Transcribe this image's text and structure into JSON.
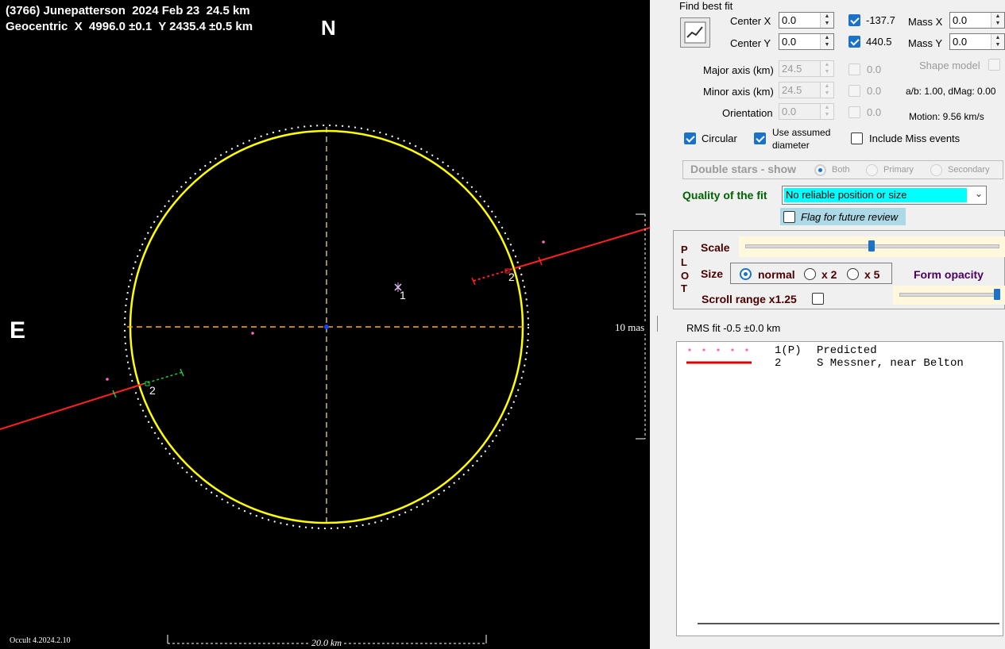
{
  "plot": {
    "title_line1": "(3766) Junepatterson  2024 Feb 23  24.5 km",
    "title_line2": "Geocentric  X  4996.0 ±0.1  Y 2435.4 ±0.5 km",
    "north_label": "N",
    "east_label": "E",
    "scale_vertical_label": "10 mas",
    "scale_horizontal_label": "20.0 km",
    "version_label": "Occult 4.2024.2.10",
    "chord_labels": [
      "1",
      "2",
      "2"
    ]
  },
  "fit": {
    "title": "Find best fit",
    "center_x_label": "Center X",
    "center_x_value": "0.0",
    "center_y_label": "Center Y",
    "center_y_value": "0.0",
    "center_x_fit": "-137.7",
    "center_y_fit": "440.5",
    "mass_x_label": "Mass X",
    "mass_x_value": "0.0",
    "mass_y_label": "Mass Y",
    "mass_y_value": "0.0",
    "major_axis_label": "Major axis (km)",
    "major_axis_value": "24.5",
    "major_axis_fit": "0.0",
    "minor_axis_label": "Minor axis (km)",
    "minor_axis_value": "24.5",
    "minor_axis_fit": "0.0",
    "orientation_label": "Orientation",
    "orientation_value": "0.0",
    "orientation_fit": "0.0",
    "shape_model_label": "Shape model",
    "ab_label": "a/b: 1.00, dMag: 0.00",
    "motion_label": "Motion: 9.56 km/s",
    "circular_label": "Circular",
    "assumed_diameter_label_1": "Use assumed",
    "assumed_diameter_label_2": "diameter",
    "include_miss_label": "Include Miss events"
  },
  "double_stars": {
    "label": "Double stars - show",
    "both": "Both",
    "primary": "Primary",
    "secondary": "Secondary"
  },
  "quality": {
    "label": "Quality of the fit",
    "selected": "No reliable position or size",
    "flag_label": "Flag for future review"
  },
  "plot_opts": {
    "side_letters": [
      "P",
      "L",
      "O",
      "T"
    ],
    "scale_label": "Scale",
    "scale_level": 0.5,
    "size_label": "Size",
    "size_normal": "normal",
    "size_x2": "x 2",
    "size_x5": "x 5",
    "form_opacity_label": "Form opacity",
    "opacity_level": 0.98,
    "scroll_range_label": "Scroll range x1.25"
  },
  "rms": {
    "label": "RMS fit -0.5 ±0.0 km"
  },
  "legend": [
    {
      "num": "1(P)",
      "name": "Predicted",
      "color": "#ff66bb"
    },
    {
      "num": "2",
      "name": "S Messner, near Belton",
      "color": "#e00000"
    }
  ],
  "colors": {
    "limb": "#ffff00",
    "chord": "#ff2020",
    "accent": "#1a73c8",
    "quality_highlight": "#00ffff"
  }
}
